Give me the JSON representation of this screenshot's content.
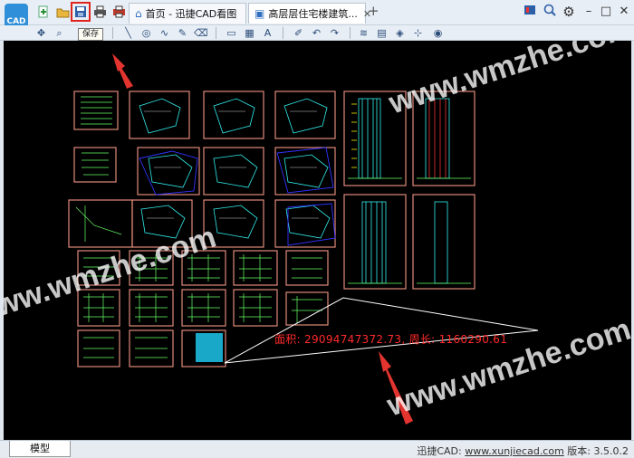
{
  "app": {
    "logo_text": "CAD",
    "tabs": [
      {
        "label": "首页 - 迅捷CAD看图",
        "active": false
      },
      {
        "label": "高层层住宅楼建筑...",
        "active": true
      }
    ],
    "tab_close": "✕",
    "tab_add": "+"
  },
  "toolbar": {
    "save_tooltip": "保存",
    "highlight_color": "#e0251f"
  },
  "canvas": {
    "background": "#000000",
    "measurement_text": "面积: 29094747372.73, 周长: 1160290.61",
    "measurement_color": "#ff2a2a",
    "watermark": "www.wmzhe.com"
  },
  "statusbar": {
    "model_tab": "模型",
    "brand_prefix": "迅捷CAD: ",
    "site": "www.xunjiecad.com",
    "version_label": " 版本: 3.5.0.2"
  }
}
